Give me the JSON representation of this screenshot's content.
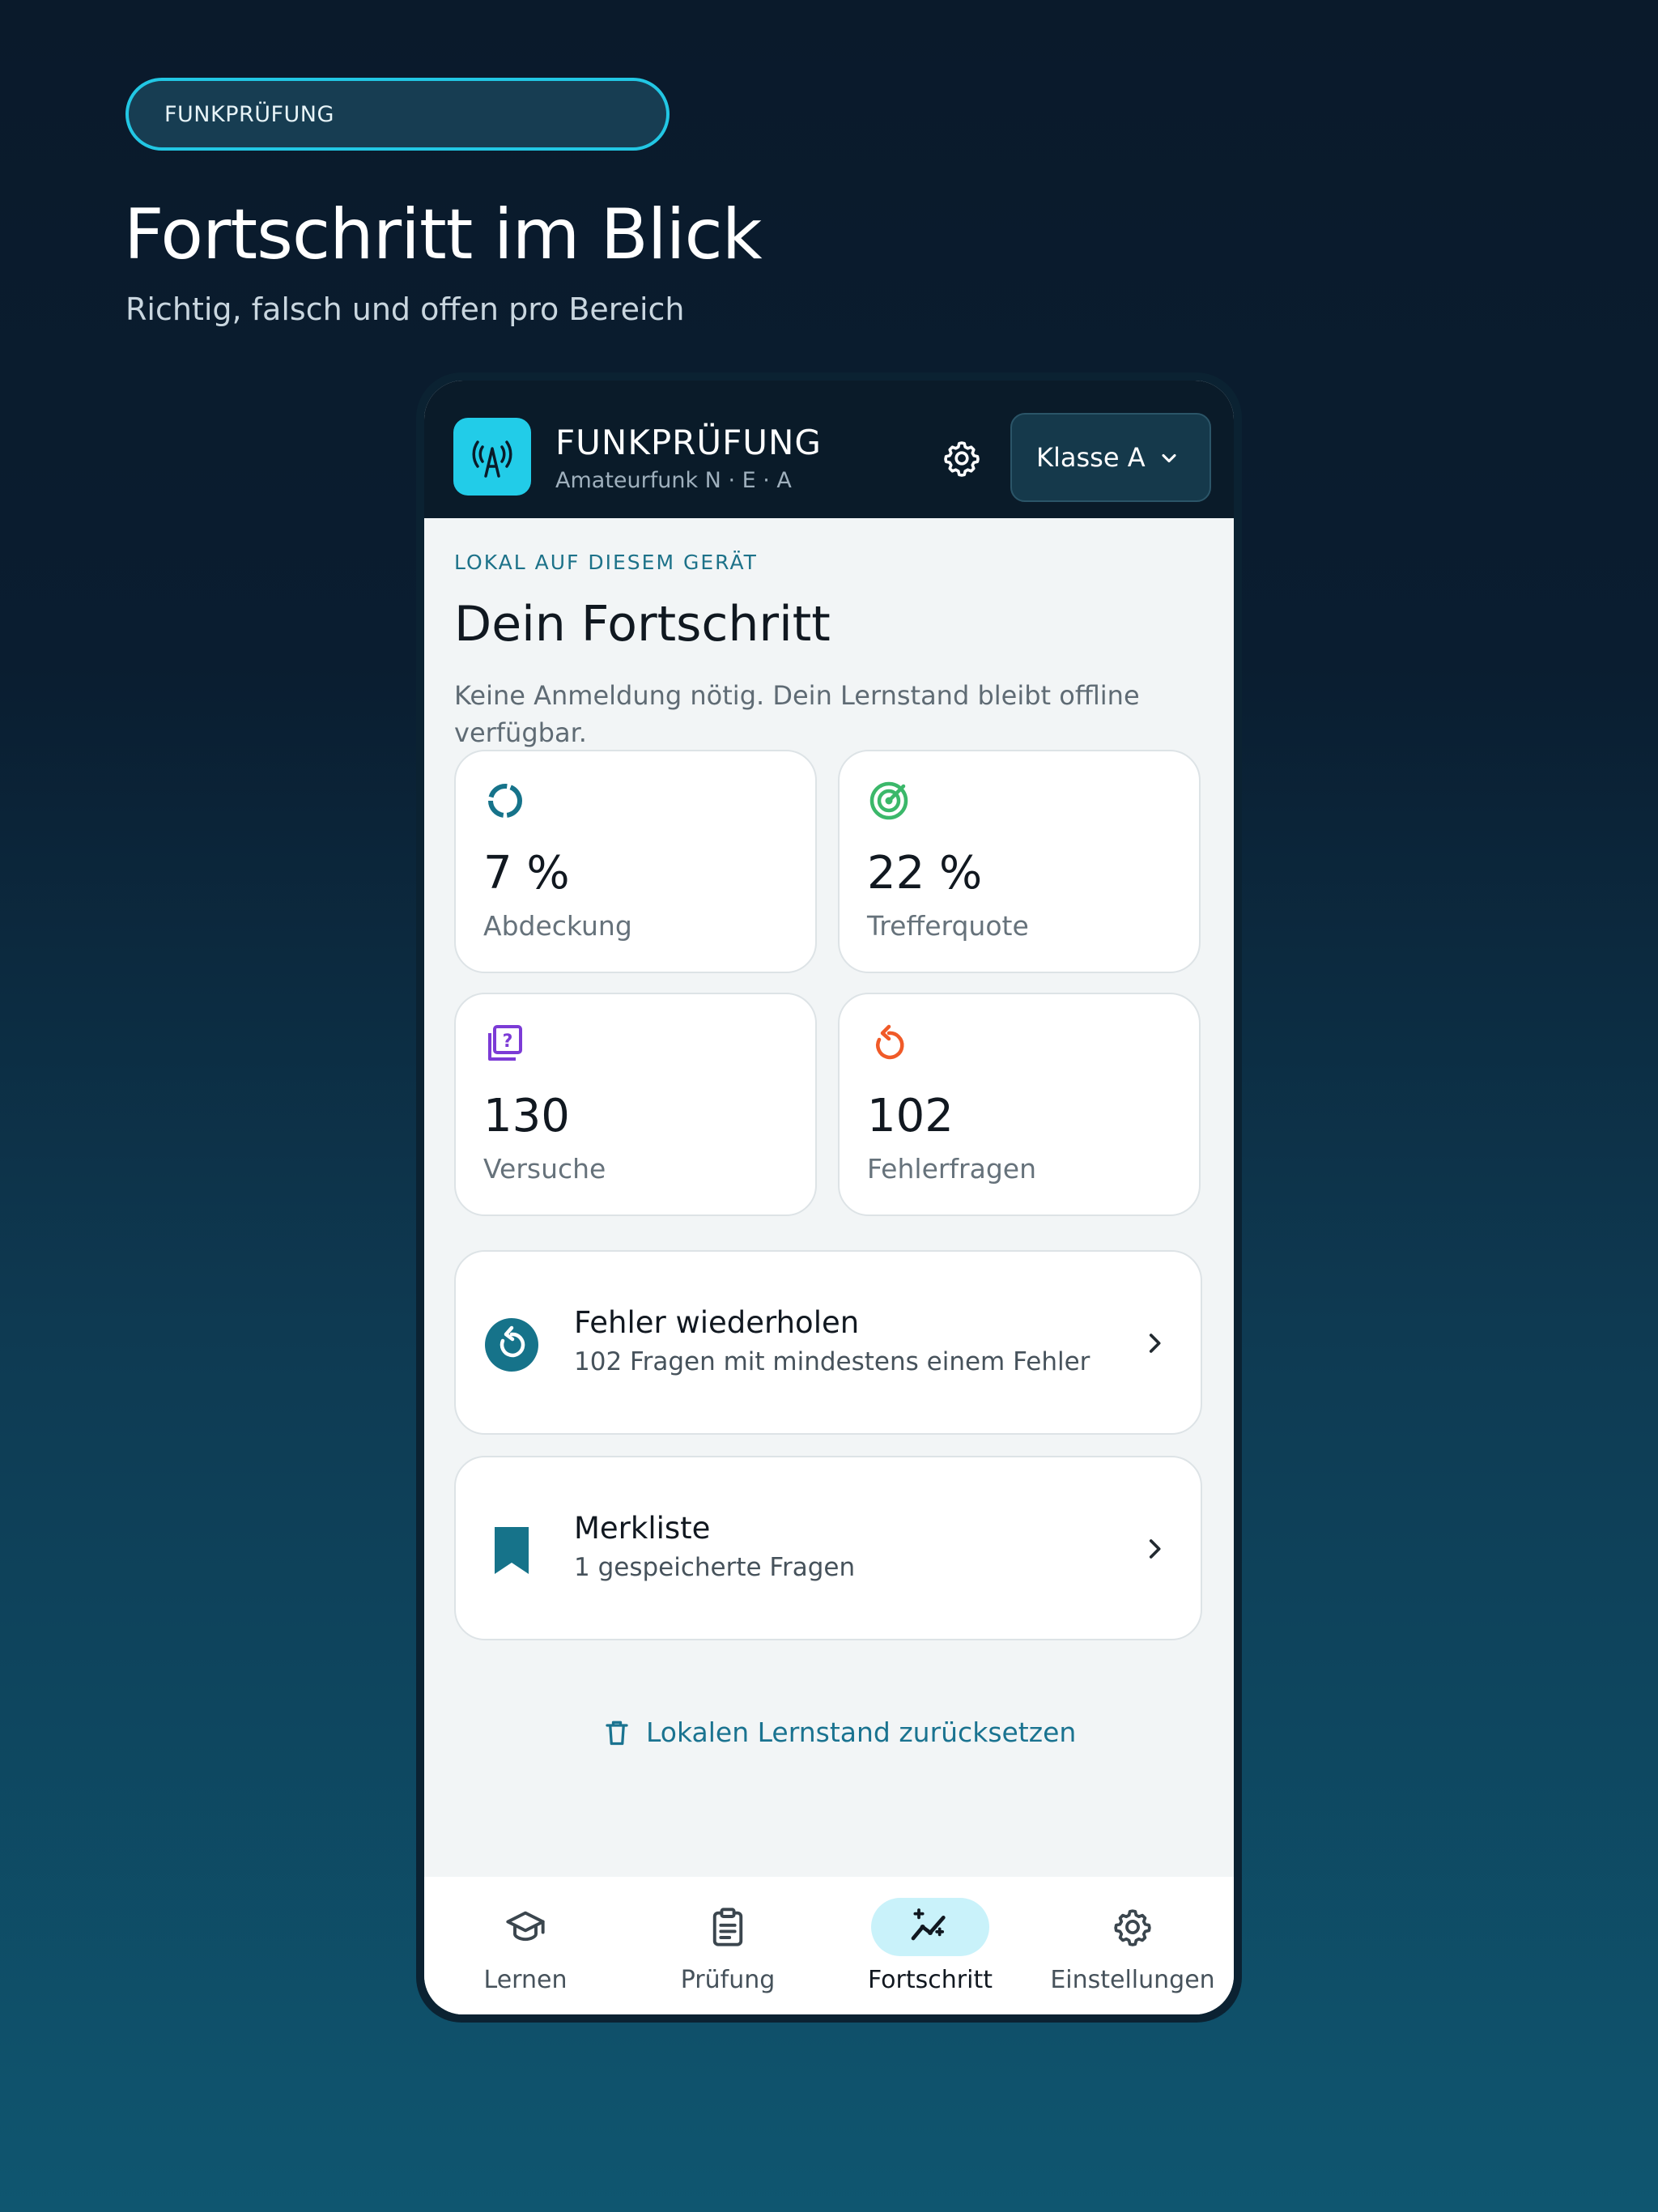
{
  "badge": "FUNKPRÜFUNG",
  "hero": {
    "title": "Fortschritt im Blick",
    "subtitle": "Richtig, falsch und offen pro Bereich"
  },
  "app": {
    "name": "FUNKPRÜFUNG",
    "subtitle": "Amateurfunk N · E · A",
    "logo_icon": "antenna-icon",
    "class_select": "Klasse A"
  },
  "progress": {
    "eyebrow": "LOKAL AUF DIESEM GERÄT",
    "title": "Dein Fortschritt",
    "description": "Keine Anmeldung nötig. Dein Lernstand bleibt offline verfügbar.",
    "stats": [
      {
        "value": "7 %",
        "label": "Abdeckung",
        "icon": "coverage-ring-icon",
        "color": "#16738a"
      },
      {
        "value": "22 %",
        "label": "Trefferquote",
        "icon": "target-icon",
        "color": "#3bb86a"
      },
      {
        "value": "130",
        "label": "Versuche",
        "icon": "question-stack-icon",
        "color": "#7c3bd6"
      },
      {
        "value": "102",
        "label": "Fehlerfragen",
        "icon": "retry-icon",
        "color": "#f05a28"
      }
    ],
    "actions": [
      {
        "title": "Fehler wiederholen",
        "subtitle": "102 Fragen mit mindestens einem Fehler",
        "icon": "replay-icon"
      },
      {
        "title": "Merkliste",
        "subtitle": "1 gespeicherte Fragen",
        "icon": "bookmark-icon"
      }
    ],
    "reset_label": "Lokalen Lernstand zurücksetzen"
  },
  "nav": [
    {
      "label": "Lernen",
      "icon": "graduation-cap-icon"
    },
    {
      "label": "Prüfung",
      "icon": "clipboard-icon"
    },
    {
      "label": "Fortschritt",
      "icon": "chart-sparkle-icon",
      "active": true
    },
    {
      "label": "Einstellungen",
      "icon": "gear-icon"
    }
  ],
  "colors": {
    "accent": "#22cce8",
    "teal": "#1a7390",
    "background_top": "#0a1a2b",
    "background_bottom": "#0f5670"
  }
}
